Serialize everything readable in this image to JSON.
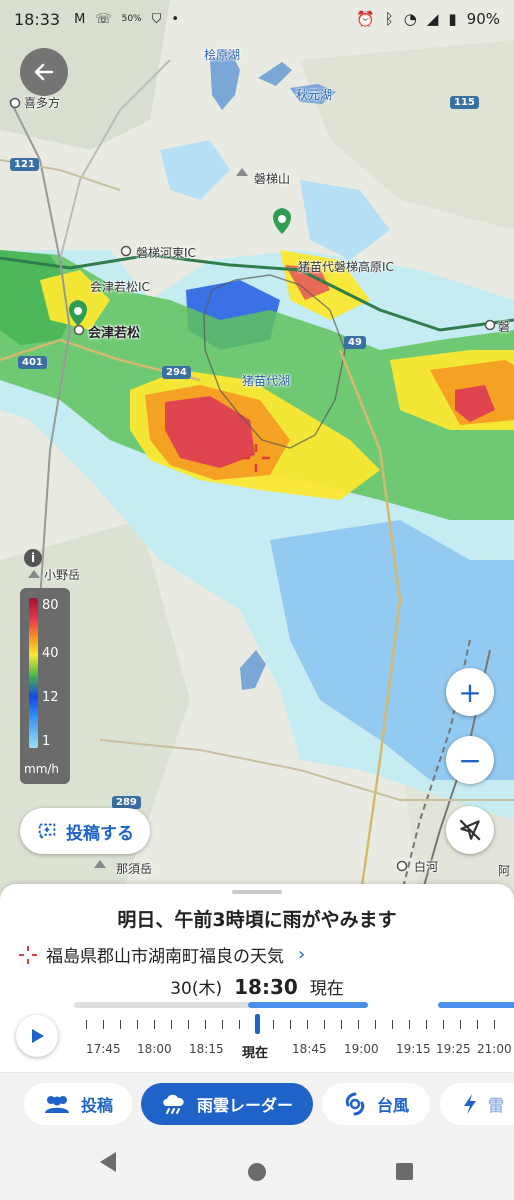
{
  "status_bar": {
    "time": "18:33",
    "left_icons": [
      "gmail-icon",
      "wifi-calling-icon",
      "data-saver-icon",
      "shield-icon",
      "dot-icon"
    ],
    "data_badge": "50%",
    "right_icons": [
      "alarm-icon",
      "bluetooth-icon",
      "wifi-icon",
      "signal-icon",
      "battery-icon"
    ],
    "battery": "90%"
  },
  "map": {
    "places": {
      "hinohara": "桧原湖",
      "kitakata": "喜多方",
      "bandaisan": "磐梯山",
      "bandai_kawahigashi": "磐梯河東IC",
      "aizuwakamatsu_ic": "会津若松IC",
      "inawashiro_bandai": "猪苗代磐梯高原IC",
      "aizuwakamatsu": "会津若松",
      "inawashiro_ko": "猪苗代湖",
      "komine": "小野岳",
      "nasudake": "那須岳",
      "shirakawa": "白河",
      "bandai_east": "磐",
      "abukuma": "阿",
      "akimoto": "秋元湖"
    },
    "routes": [
      "121",
      "401",
      "294",
      "49",
      "115",
      "289"
    ],
    "legend": {
      "ticks": [
        "80",
        "40",
        "12",
        "1"
      ],
      "unit": "mm/h",
      "colors": [
        "#9e1537",
        "#e8394a",
        "#f5a123",
        "#fbe832",
        "#43b64a",
        "#1747e8",
        "#2d8cf2",
        "#9ae1f5"
      ]
    },
    "post_button": "投稿する",
    "zoom_in": "+",
    "zoom_out": "−"
  },
  "sheet": {
    "headline": "明日、午前3時頃に雨がやみます",
    "location": "福島県郡山市湖南町福良の天気",
    "date": "30(木)",
    "time": "18:30",
    "now_label": "現在",
    "timeline_labels": [
      "17:45",
      "18:00",
      "18:15",
      "現在",
      "18:45",
      "19:00",
      "19:15",
      "19:25",
      "21:00"
    ]
  },
  "tabs": [
    {
      "label": "投稿",
      "icon": "people-icon"
    },
    {
      "label": "雨雲レーダー",
      "icon": "rain-cloud-icon"
    },
    {
      "label": "台風",
      "icon": "typhoon-icon"
    },
    {
      "label": "雷",
      "icon": "lightning-icon"
    }
  ],
  "accent_color": "#1f63c9"
}
